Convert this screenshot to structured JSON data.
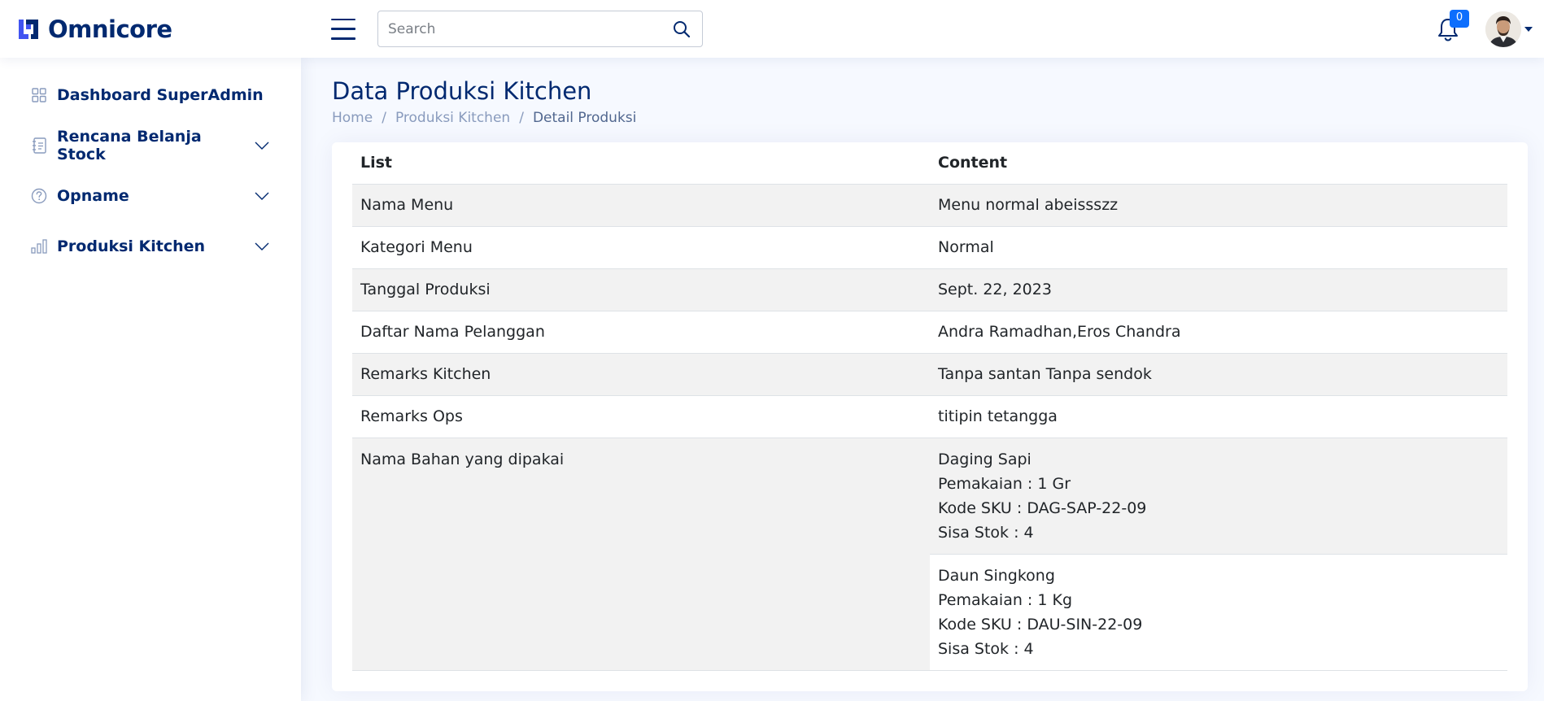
{
  "app": {
    "brand": "Omnicore",
    "colors": {
      "brand": "#012970",
      "accent": "#4154f1",
      "badge": "#0d6efd",
      "muted": "#899bbd"
    }
  },
  "header": {
    "search": {
      "placeholder": "Search",
      "value": ""
    },
    "notifications": {
      "count": "0",
      "icon": "bell-icon"
    },
    "profile": {
      "icon": "avatar"
    }
  },
  "sidebar": {
    "items": [
      {
        "label": "Dashboard SuperAdmin",
        "icon": "grid-icon",
        "has_submenu": false
      },
      {
        "label": "Rencana Belanja Stock",
        "icon": "journal-icon",
        "has_submenu": true
      },
      {
        "label": "Opname",
        "icon": "question-circle-icon",
        "has_submenu": true
      },
      {
        "label": "Produksi Kitchen",
        "icon": "bar-chart-icon",
        "has_submenu": true
      }
    ]
  },
  "page": {
    "title": "Data Produksi Kitchen",
    "breadcrumb": [
      "Home",
      "Produksi Kitchen",
      "Detail Produksi"
    ]
  },
  "table": {
    "headers": [
      "List",
      "Content"
    ],
    "rows": [
      {
        "label": "Nama Menu",
        "value": "Menu normal abeissszz"
      },
      {
        "label": "Kategori Menu",
        "value": "Normal"
      },
      {
        "label": "Tanggal Produksi",
        "value": "Sept. 22, 2023"
      },
      {
        "label": "Daftar Nama Pelanggan",
        "value": "Andra Ramadhan,Eros Chandra"
      },
      {
        "label": "Remarks Kitchen",
        "value": "Tanpa santan Tanpa sendok"
      },
      {
        "label": "Remarks Ops",
        "value": "titipin tetangga"
      }
    ],
    "materials_label": "Nama Bahan yang dipakai",
    "materials": [
      {
        "name": "Daging Sapi",
        "usage": "Pemakaian : 1 Gr",
        "sku": "Kode SKU : DAG-SAP-22-09",
        "stock": "Sisa Stok : 4"
      },
      {
        "name": "Daun Singkong",
        "usage": "Pemakaian : 1 Kg",
        "sku": "Kode SKU : DAU-SIN-22-09",
        "stock": "Sisa Stok : 4"
      }
    ]
  }
}
